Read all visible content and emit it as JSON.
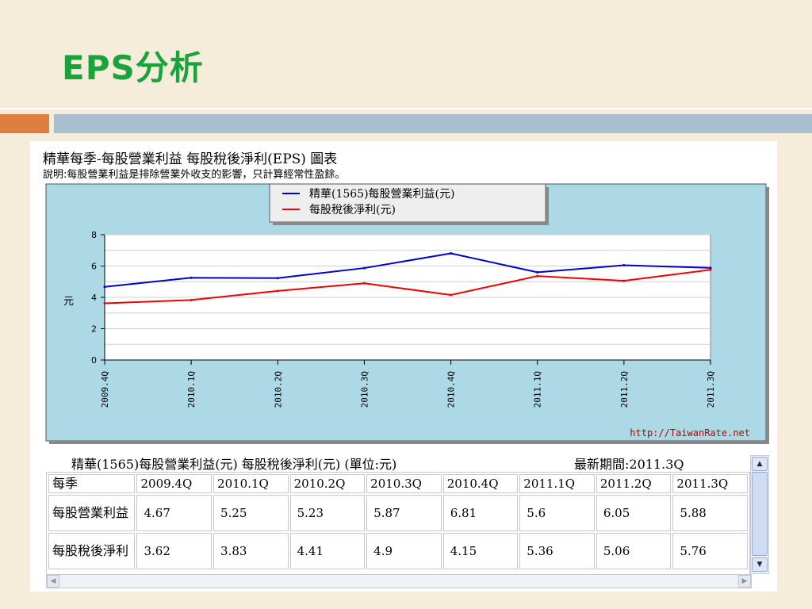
{
  "slide": {
    "title": "EPS分析"
  },
  "chart_heading": "精華每季-每股營業利益 每股稅後淨利(EPS) 圖表",
  "chart_note": "說明:每股營業利益是排除營業外收支的影響，只計算經常性盈餘。",
  "watermark": "http://TaiwanRate.net",
  "chart_data": {
    "type": "line",
    "categories": [
      "2009.4Q",
      "2010.1Q",
      "2010.2Q",
      "2010.3Q",
      "2010.4Q",
      "2011.1Q",
      "2011.2Q",
      "2011.3Q"
    ],
    "series": [
      {
        "name": "精華(1565)每股營業利益(元)",
        "color": "#0000cc",
        "values": [
          4.67,
          5.25,
          5.23,
          5.87,
          6.81,
          5.6,
          6.05,
          5.88
        ]
      },
      {
        "name": "每股稅後淨利(元)",
        "color": "#ee0000",
        "values": [
          3.62,
          3.83,
          4.41,
          4.9,
          4.15,
          5.36,
          5.06,
          5.76
        ]
      }
    ],
    "ylabel": "元",
    "ylim": [
      0,
      8
    ],
    "yticks": [
      0,
      2,
      4,
      6,
      8
    ],
    "grid": true,
    "legend": "top-center"
  },
  "table": {
    "caption": "精華(1565)每股營業利益(元) 每股稅後淨利(元) (單位:元)",
    "latest": "最新期間:2011.3Q",
    "header_label": "每季",
    "columns": [
      "2009.4Q",
      "2010.1Q",
      "2010.2Q",
      "2010.3Q",
      "2010.4Q",
      "2011.1Q",
      "2011.2Q",
      "2011.3Q"
    ],
    "rows": [
      {
        "label": "每股營業利益",
        "values": [
          "4.67",
          "5.25",
          "5.23",
          "5.87",
          "6.81",
          "5.6",
          "6.05",
          "5.88"
        ]
      },
      {
        "label": "每股稅後淨利",
        "values": [
          "3.62",
          "3.83",
          "4.41",
          "4.9",
          "4.15",
          "5.36",
          "5.06",
          "5.76"
        ]
      }
    ]
  },
  "colors": {
    "title_green": "#1aa33a",
    "accent_orange": "#de7f40",
    "accent_blue": "#a9bfd0",
    "chart_bg": "#add8e6",
    "background": "#f5ecda"
  }
}
